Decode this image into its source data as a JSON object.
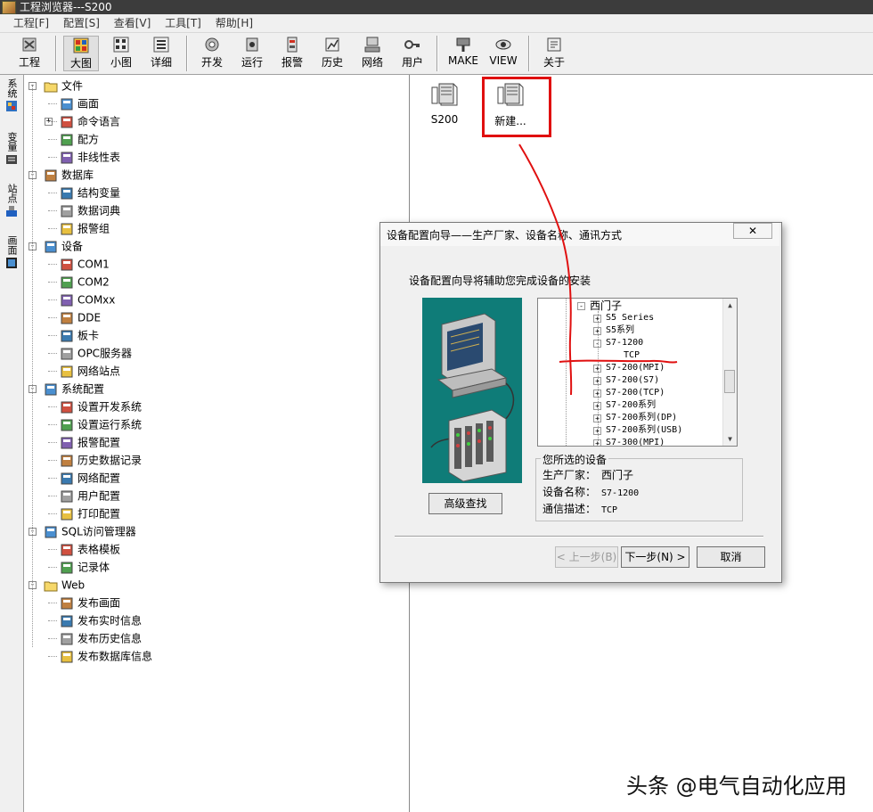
{
  "window": {
    "title": "工程浏览器---S200"
  },
  "menu": [
    {
      "label": "工程[F]"
    },
    {
      "label": "配置[S]"
    },
    {
      "label": "查看[V]"
    },
    {
      "label": "工具[T]"
    },
    {
      "label": "帮助[H]"
    }
  ],
  "toolbar": [
    {
      "label": "工程",
      "icon": "project-icon"
    },
    {
      "label": "大图",
      "icon": "large-icons-icon"
    },
    {
      "label": "小图",
      "icon": "small-icons-icon"
    },
    {
      "label": "详细",
      "icon": "details-icon"
    },
    {
      "label": "开发",
      "icon": "develop-icon"
    },
    {
      "label": "运行",
      "icon": "run-icon"
    },
    {
      "label": "报警",
      "icon": "alarm-icon"
    },
    {
      "label": "历史",
      "icon": "history-icon"
    },
    {
      "label": "网络",
      "icon": "network-icon"
    },
    {
      "label": "用户",
      "icon": "user-key-icon"
    },
    {
      "label": "MAKE",
      "icon": "make-icon"
    },
    {
      "label": "VIEW",
      "icon": "view-icon"
    },
    {
      "label": "关于",
      "icon": "about-icon"
    }
  ],
  "side_tabs": [
    {
      "label": "系统"
    },
    {
      "label": "变量"
    },
    {
      "label": "站点"
    },
    {
      "label": "画面"
    }
  ],
  "tree": [
    {
      "label": "文件",
      "level": 0,
      "expander": "−",
      "icon": "folder-icon"
    },
    {
      "label": "画面",
      "level": 1,
      "icon": "picture-icon"
    },
    {
      "label": "命令语言",
      "level": 1,
      "expander": "+",
      "icon": "script-icon"
    },
    {
      "label": "配方",
      "level": 1,
      "icon": "recipe-icon"
    },
    {
      "label": "非线性表",
      "level": 1,
      "icon": "table-icon"
    },
    {
      "label": "数据库",
      "level": 0,
      "expander": "−",
      "icon": "database-icon"
    },
    {
      "label": "结构变量",
      "level": 1,
      "icon": "struct-icon"
    },
    {
      "label": "数据词典",
      "level": 1,
      "icon": "dictionary-icon"
    },
    {
      "label": "报警组",
      "level": 1,
      "icon": "alarm-group-icon"
    },
    {
      "label": "设备",
      "level": 0,
      "expander": "−",
      "icon": "device-icon"
    },
    {
      "label": "COM1",
      "level": 1,
      "icon": "com-port-icon",
      "selected": true
    },
    {
      "label": "COM2",
      "level": 1,
      "icon": "com-port-icon"
    },
    {
      "label": "COMxx",
      "level": 1,
      "icon": "comxx-icon"
    },
    {
      "label": "DDE",
      "level": 1,
      "icon": "dde-icon"
    },
    {
      "label": "板卡",
      "level": 1,
      "icon": "board-icon"
    },
    {
      "label": "OPC服务器",
      "level": 1,
      "icon": "opc-icon"
    },
    {
      "label": "网络站点",
      "level": 1,
      "icon": "network-station-icon"
    },
    {
      "label": "系统配置",
      "level": 0,
      "expander": "−",
      "icon": "tools-icon"
    },
    {
      "label": "设置开发系统",
      "level": 1,
      "icon": "dev-settings-icon"
    },
    {
      "label": "设置运行系统",
      "level": 1,
      "icon": "run-settings-icon"
    },
    {
      "label": "报警配置",
      "level": 1,
      "icon": "alarm-config-icon"
    },
    {
      "label": "历史数据记录",
      "level": 1,
      "icon": "history-record-icon"
    },
    {
      "label": "网络配置",
      "level": 1,
      "icon": "network-config-icon"
    },
    {
      "label": "用户配置",
      "level": 1,
      "icon": "user-config-icon"
    },
    {
      "label": "打印配置",
      "level": 1,
      "icon": "printer-icon"
    },
    {
      "label": "SQL访问管理器",
      "level": 0,
      "expander": "−",
      "icon": "sql-icon"
    },
    {
      "label": "表格模板",
      "level": 1,
      "icon": "table-template-icon"
    },
    {
      "label": "记录体",
      "level": 1,
      "icon": "record-icon"
    },
    {
      "label": "Web",
      "level": 0,
      "expander": "−",
      "icon": "folder-icon"
    },
    {
      "label": "发布画面",
      "level": 1,
      "icon": "publish-picture-icon"
    },
    {
      "label": "发布实时信息",
      "level": 1,
      "icon": "publish-realtime-icon"
    },
    {
      "label": "发布历史信息",
      "level": 1,
      "icon": "publish-history-icon"
    },
    {
      "label": "发布数据库信息",
      "level": 1,
      "icon": "publish-database-icon"
    }
  ],
  "project_items": [
    {
      "label": "S200",
      "icon": "device-clip-icon"
    },
    {
      "label": "新建...",
      "icon": "device-clip-icon"
    }
  ],
  "dialog": {
    "title": "设备配置向导——生产厂家、设备名称、通讯方式",
    "close": "✕",
    "description": "设备配置向导将辅助您完成设备的安装",
    "device_tree": [
      {
        "label": "西门子",
        "depth": 0,
        "expander": "−"
      },
      {
        "label": "S5 Series",
        "depth": 1,
        "expander": "+"
      },
      {
        "label": "S5系列",
        "depth": 1,
        "expander": "+"
      },
      {
        "label": "S7-1200",
        "depth": 1,
        "expander": "−"
      },
      {
        "label": "TCP",
        "depth": 2
      },
      {
        "label": "S7-200(MPI)",
        "depth": 1,
        "expander": "+"
      },
      {
        "label": "S7-200(S7)",
        "depth": 1,
        "expander": "+"
      },
      {
        "label": "S7-200(TCP)",
        "depth": 1,
        "expander": "+"
      },
      {
        "label": "S7-200系列",
        "depth": 1,
        "expander": "+"
      },
      {
        "label": "S7-200系列(DP)",
        "depth": 1,
        "expander": "+"
      },
      {
        "label": "S7-200系列(USB)",
        "depth": 1,
        "expander": "+"
      },
      {
        "label": "S7-300(MPI)",
        "depth": 1,
        "expander": "+"
      }
    ],
    "selected_device": {
      "legend": "您所选的设备",
      "manufacturer_label": "生产厂家：",
      "manufacturer": "西门子",
      "device_label": "设备名称：",
      "device": "S7-1200",
      "comm_label": "通信描述：",
      "comm": "TCP"
    },
    "buttons": {
      "advanced": "高级查找",
      "prev": "< 上一步(B)",
      "next": "下一步(N) >",
      "cancel": "取消"
    }
  },
  "watermark": "头条 @电气自动化应用",
  "colors": {
    "illustration_bg": "#0f7c78",
    "annotation_red": "#e01010",
    "titlebar": "#3c3c3c"
  }
}
